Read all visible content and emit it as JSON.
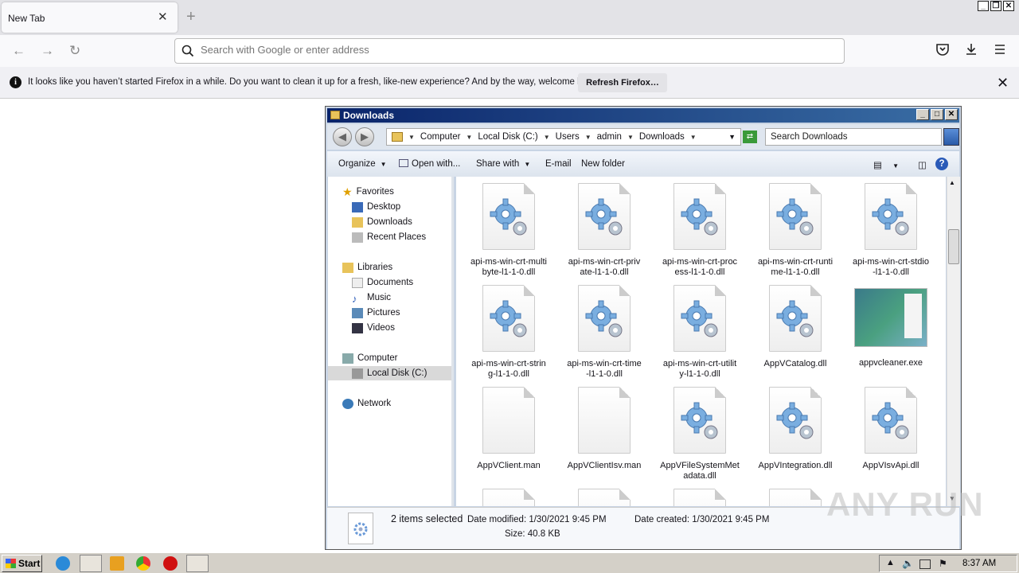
{
  "browser": {
    "tab_title": "New Tab",
    "url_placeholder": "Search with Google or enter address"
  },
  "notification": {
    "message": "It looks like you haven’t started Firefox in a while. Do you want to clean it up for a fresh, like-new experience? And by the way, welcome back!",
    "refresh_label": "Refresh Firefox…"
  },
  "explorer": {
    "title": "Downloads",
    "breadcrumb": [
      "Computer",
      "Local Disk (C:)",
      "Users",
      "admin",
      "Downloads"
    ],
    "search_placeholder": "Search Downloads",
    "commands": {
      "organize": "Organize",
      "open_with": "Open with...",
      "share_with": "Share with",
      "email": "E-mail",
      "new_folder": "New folder"
    },
    "nav": {
      "favorites": "Favorites",
      "desktop": "Desktop",
      "downloads": "Downloads",
      "recent_places": "Recent Places",
      "libraries": "Libraries",
      "documents": "Documents",
      "music": "Music",
      "pictures": "Pictures",
      "videos": "Videos",
      "computer": "Computer",
      "local_disk": "Local Disk (C:)",
      "network": "Network"
    },
    "files": [
      {
        "name": [
          "api-ms-win-crt-multi",
          "byte-l1-1-0.dll"
        ],
        "type": "dll"
      },
      {
        "name": [
          "api-ms-win-crt-priv",
          "ate-l1-1-0.dll"
        ],
        "type": "dll"
      },
      {
        "name": [
          "api-ms-win-crt-proc",
          "ess-l1-1-0.dll"
        ],
        "type": "dll"
      },
      {
        "name": [
          "api-ms-win-crt-runti",
          "me-l1-1-0.dll"
        ],
        "type": "dll"
      },
      {
        "name": [
          "api-ms-win-crt-stdio",
          "-l1-1-0.dll"
        ],
        "type": "dll"
      },
      {
        "name": [
          "api-ms-win-crt-strin",
          "g-l1-1-0.dll"
        ],
        "type": "dll"
      },
      {
        "name": [
          "api-ms-win-crt-time",
          "-l1-1-0.dll"
        ],
        "type": "dll"
      },
      {
        "name": [
          "api-ms-win-crt-utilit",
          "y-l1-1-0.dll"
        ],
        "type": "dll"
      },
      {
        "name": [
          "AppVCatalog.dll",
          ""
        ],
        "type": "dll"
      },
      {
        "name": [
          "appvcleaner.exe",
          ""
        ],
        "type": "exe"
      },
      {
        "name": [
          "AppVClient.man",
          ""
        ],
        "type": "blank"
      },
      {
        "name": [
          "AppVClientIsv.man",
          ""
        ],
        "type": "blank"
      },
      {
        "name": [
          "AppVFileSystemMet",
          "adata.dll"
        ],
        "type": "dll"
      },
      {
        "name": [
          "AppVIntegration.dll",
          ""
        ],
        "type": "dll"
      },
      {
        "name": [
          "AppVIsvApi.dll",
          ""
        ],
        "type": "dll"
      }
    ],
    "status": {
      "selection": "2 items selected",
      "date_modified": "Date modified: 1/30/2021 9:45 PM",
      "date_created": "Date created: 1/30/2021 9:45 PM",
      "size": "Size: 40.8 KB"
    }
  },
  "watermark": "ANY RUN",
  "taskbar": {
    "start_label": "Start",
    "clock": "8:37 AM"
  }
}
